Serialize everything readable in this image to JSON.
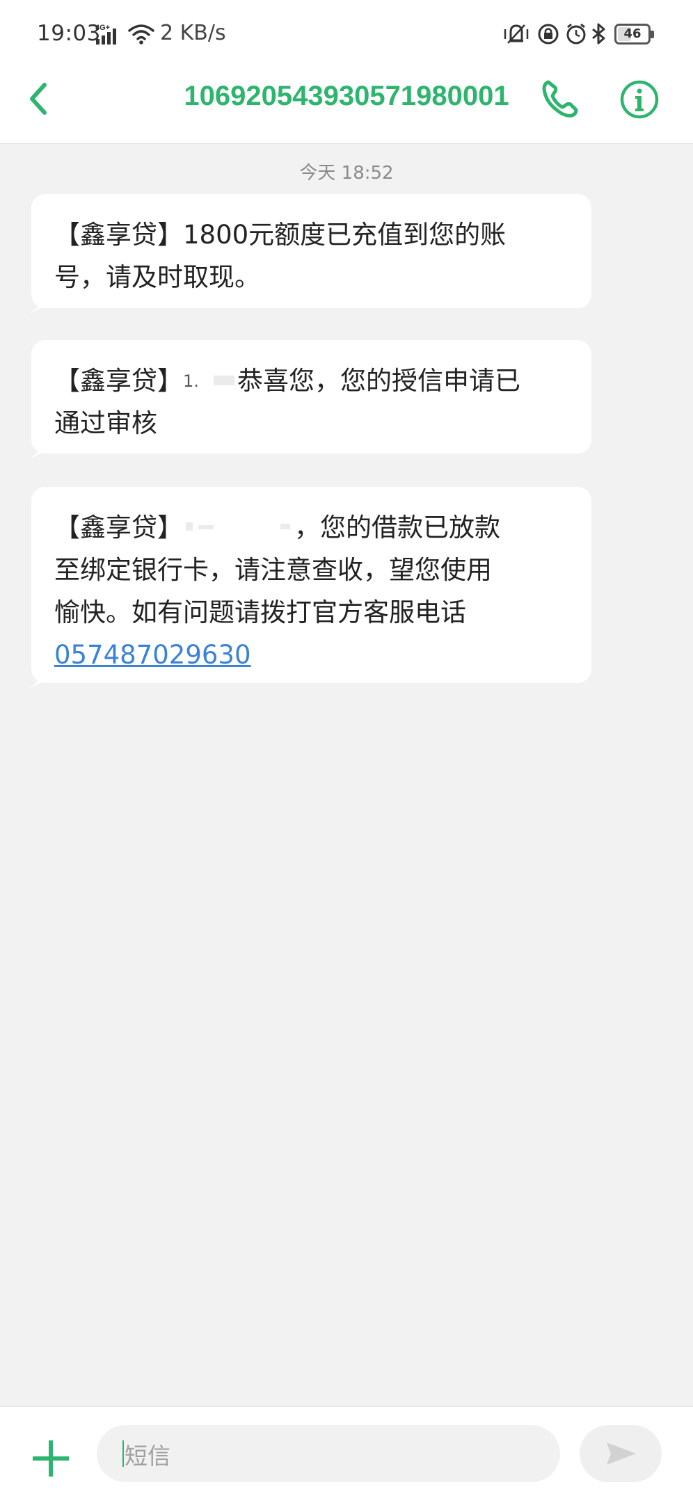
{
  "status_bar": {
    "time": "19:03",
    "network": "4G+",
    "speed": "2 KB/s",
    "battery": "46",
    "battery_level": 0.46,
    "icons": [
      "signal-icon",
      "wifi-icon",
      "vibrate-icon",
      "lock-icon",
      "alarm-icon",
      "bluetooth-icon",
      "battery-icon"
    ]
  },
  "header": {
    "title": "106920543930571980001",
    "back_icon": "chevron-left-icon",
    "call_icon": "phone-icon",
    "info_icon": "info-icon"
  },
  "conversation": {
    "date_label": "今天 18:52",
    "messages": [
      {
        "line1": "【鑫享贷】1800元额度已充值到您的账",
        "line2": "号，请及时取现。"
      },
      {
        "prefix": "【鑫享贷】",
        "redacted_glyph": "1.",
        "line1_tail": "恭喜您，您的授信申请已",
        "line2": "通过审核"
      },
      {
        "prefix": "【鑫享贷】",
        "line1_tail": "，您的借款已放款",
        "line2": "至绑定银行卡，请注意查收，望您使用",
        "line3": "愉快。如有问题请拨打官方客服电话",
        "phone": "057487029630"
      }
    ]
  },
  "composer": {
    "placeholder": "短信",
    "plus_icon": "plus-icon",
    "send_icon": "send-icon"
  },
  "colors": {
    "accent": "#2db46d",
    "link": "#3a82d8",
    "background": "#f2f2f2",
    "bubble": "#ffffff"
  }
}
